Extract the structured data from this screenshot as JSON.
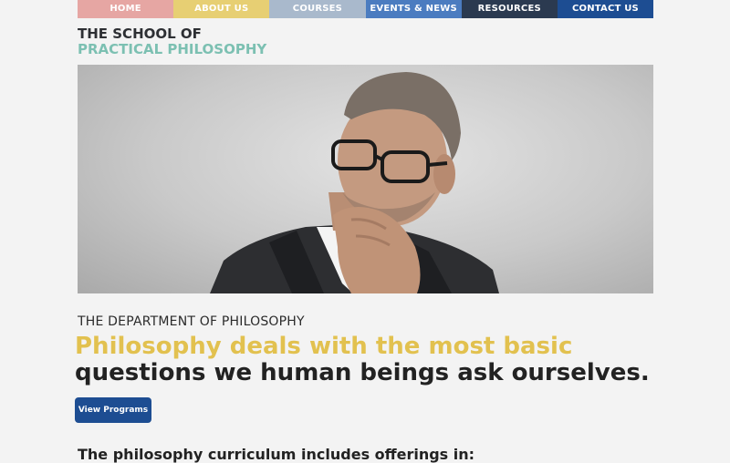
{
  "nav": {
    "items": [
      {
        "label": "HOME"
      },
      {
        "label": "ABOUT US"
      },
      {
        "label": "COURSES"
      },
      {
        "label": "EVENTS & NEWS"
      },
      {
        "label": "RESOURCES"
      },
      {
        "label": "CONTACT US"
      }
    ],
    "colors": [
      "#e6a6a3",
      "#e7cf73",
      "#a9b9cc",
      "#4b7cc0",
      "#2b3a50",
      "#1d4d92"
    ]
  },
  "logo": {
    "line1": "THE SCHOOL OF",
    "line2": "PRACTICAL PHILOSOPHY"
  },
  "hero": {
    "image": "man-thinking-photo"
  },
  "main": {
    "department": "THE DEPARTMENT OF PHILOSOPHY",
    "headline_line1": "Philosophy deals with the most basic",
    "headline_line2": "questions we human beings ask ourselves.",
    "cta_label": "View Programs",
    "curriculum_heading": "The philosophy curriculum includes offerings in:"
  }
}
